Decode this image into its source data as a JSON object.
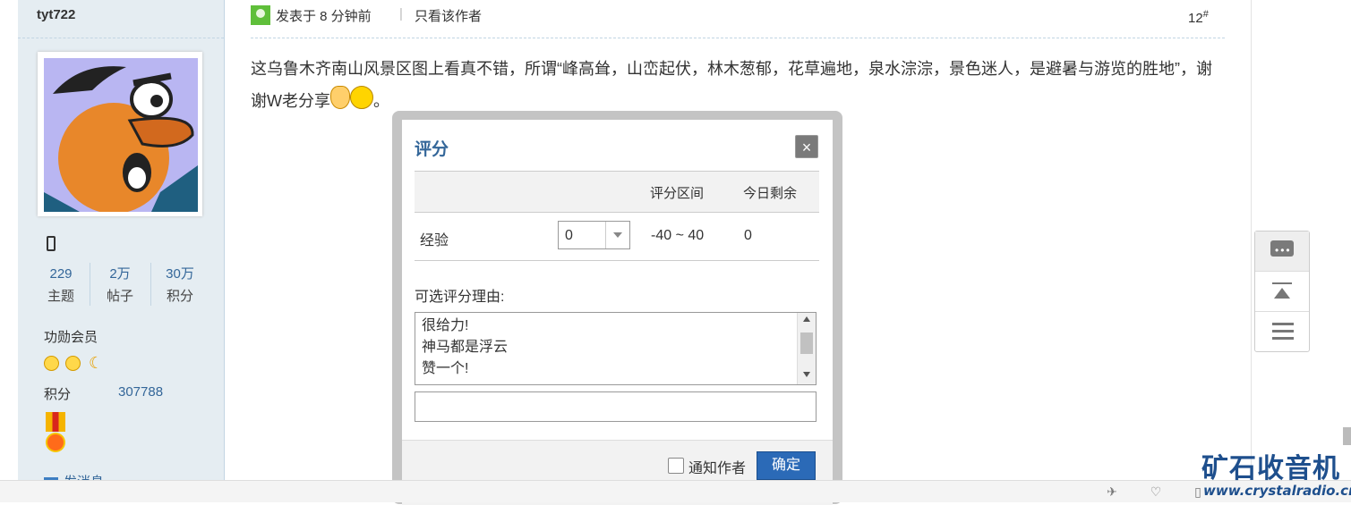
{
  "user": {
    "name": "tyt722",
    "stats": [
      {
        "num": "229",
        "label": "主题"
      },
      {
        "num": "2万",
        "label": "帖子"
      },
      {
        "num": "30万",
        "label": "积分"
      }
    ],
    "group": "功勋会员",
    "credit_label": "积分",
    "credit_value": "307788",
    "send_message": "发消息"
  },
  "post": {
    "time": "发表于 8 分钟前",
    "separator": "|",
    "only_author": "只看该作者",
    "floor": "12",
    "floor_mark": "#",
    "text": "这乌鲁木齐南山风景区图上看真不错，所谓“峰高耸，山峦起伏，林木葱郁，花草遍地，泉水淙淙，景色迷人，是避暑与游览的胜地”，谢谢W老分享",
    "text_end": "。"
  },
  "rate_dialog": {
    "title": "评分",
    "close_glyph": "×",
    "col_range": "评分区间",
    "col_remain": "今日剩余",
    "row": {
      "label": "经验",
      "value": "0",
      "range": "-40 ~ 40",
      "remain": "0"
    },
    "reason_label": "可选评分理由:",
    "reasons": [
      "很给力!",
      "神马都是浮云",
      "赞一个!"
    ],
    "notify_label": "通知作者",
    "confirm": "确定"
  },
  "watermark": {
    "brand": "矿石收音机",
    "url": "www.crystalradio.cn"
  },
  "icons": [
    "phone-icon",
    "comment-icon",
    "back-to-top-icon",
    "list-icon",
    "close-icon",
    "message-icon"
  ],
  "colors": {
    "link": "#336699",
    "sidebar_bg": "#e5edf2",
    "confirm_bg": "#2b6ab7",
    "watermark": "#1e4f8d"
  }
}
